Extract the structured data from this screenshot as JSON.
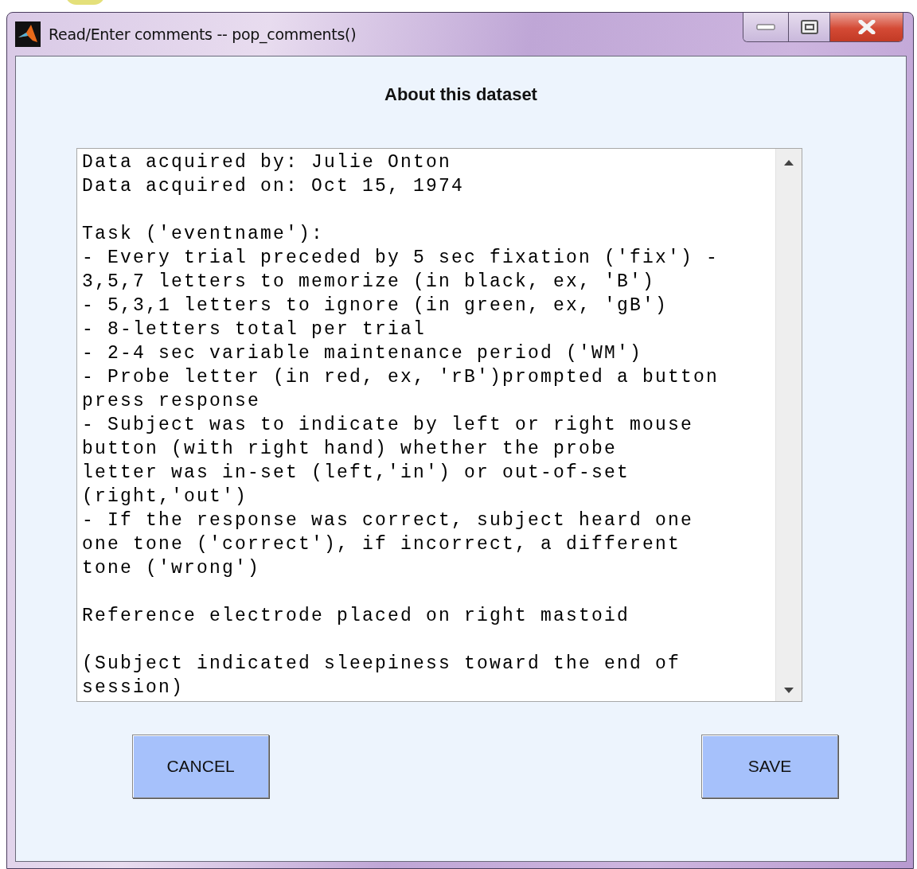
{
  "window": {
    "title": "Read/Enter comments -- pop_comments()",
    "controls": [
      {
        "kind": "minimize"
      },
      {
        "kind": "maximize"
      },
      {
        "kind": "close"
      }
    ]
  },
  "heading": "About this dataset",
  "comments": {
    "paragraphs": [
      [
        "Data acquired by: Julie Onton",
        "Data acquired on: Oct 15, 1974"
      ],
      [
        "Task ('eventname'):",
        "- Every trial preceded by 5 sec fixation ('fix') -",
        "3,5,7 letters to memorize (in black, ex, 'B')",
        "- 5,3,1 letters to ignore (in green, ex, 'gB')",
        "- 8-letters total per trial",
        "- 2-4 sec variable maintenance period ('WM')",
        "- Probe letter (in red, ex, 'rB')prompted a button",
        "press response",
        "- Subject was to indicate by left or right mouse",
        "button (with right hand) whether the probe",
        "letter was in-set (left,'in') or out-of-set",
        "(right,'out')",
        "- If the response was correct, subject heard one",
        "one tone ('correct'), if incorrect, a different",
        "tone ('wrong')"
      ],
      [
        "Reference electrode placed on right mastoid"
      ],
      [
        "(Subject indicated sleepiness toward the end of",
        "session)"
      ]
    ]
  },
  "buttons": [
    "CANCEL",
    "SAVE"
  ]
}
